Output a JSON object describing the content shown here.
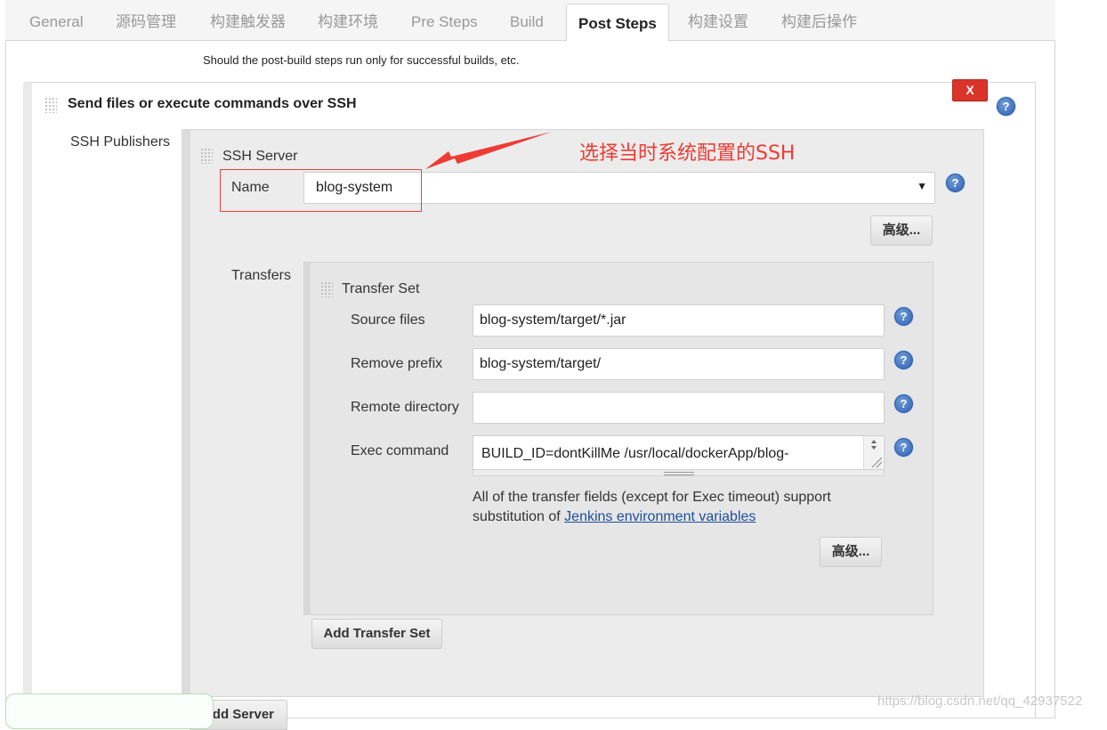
{
  "tabs": [
    {
      "label": "General",
      "active": false
    },
    {
      "label": "源码管理",
      "active": false
    },
    {
      "label": "构建触发器",
      "active": false
    },
    {
      "label": "构建环境",
      "active": false
    },
    {
      "label": "Pre Steps",
      "active": false
    },
    {
      "label": "Build",
      "active": false
    },
    {
      "label": "Post Steps",
      "active": true
    },
    {
      "label": "构建设置",
      "active": false
    },
    {
      "label": "构建后操作",
      "active": false
    }
  ],
  "hint_text": "Should the post-build steps run only for successful builds, etc.",
  "section": {
    "title": "Send files or execute commands over SSH",
    "delete_label": "X",
    "help_label": "?"
  },
  "publishers_label": "SSH Publishers",
  "server": {
    "title": "SSH Server",
    "name_label": "Name",
    "name_value": "blog-system",
    "caret": "▼",
    "advanced_label": "高级...",
    "annotation": "选择当时系统配置的SSH"
  },
  "transfers": {
    "label": "Transfers",
    "set_title": "Transfer Set",
    "source_files_label": "Source files",
    "source_files_value": "blog-system/target/*.jar",
    "remove_prefix_label": "Remove prefix",
    "remove_prefix_value": "blog-system/target/",
    "remote_directory_label": "Remote directory",
    "remote_directory_value": "",
    "exec_command_label": "Exec command",
    "exec_command_value": "BUILD_ID=dontKillMe /usr/local/dockerApp/blog-",
    "desc_text": "All of the transfer fields (except for Exec timeout) support",
    "desc_text2": "substitution of ",
    "desc_link": "Jenkins environment variables",
    "advanced_label": "高级...",
    "add_transfer_set_label": "Add Transfer Set"
  },
  "add_server_label": "Add Server",
  "watermark": "https://blog.csdn.net/qq_42937522"
}
